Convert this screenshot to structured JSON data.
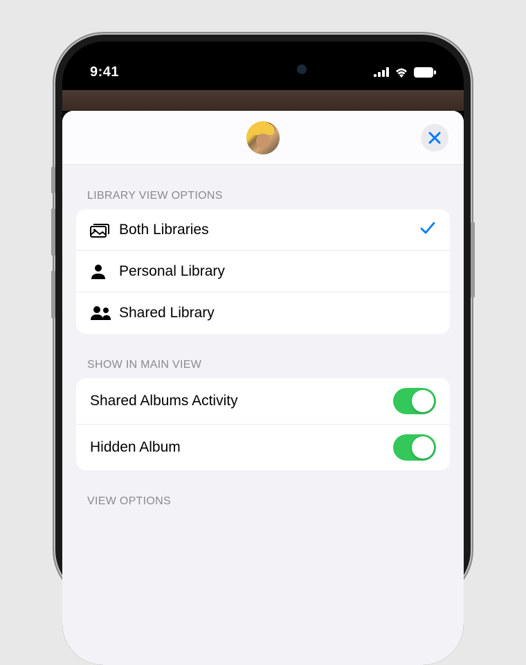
{
  "status": {
    "time": "9:41"
  },
  "sections": {
    "library": {
      "header": "LIBRARY VIEW OPTIONS",
      "items": [
        {
          "label": "Both Libraries",
          "icon": "stack-icon",
          "selected": true
        },
        {
          "label": "Personal Library",
          "icon": "person-icon",
          "selected": false
        },
        {
          "label": "Shared Library",
          "icon": "people-icon",
          "selected": false
        }
      ]
    },
    "mainview": {
      "header": "SHOW IN MAIN VIEW",
      "items": [
        {
          "label": "Shared Albums Activity",
          "enabled": true
        },
        {
          "label": "Hidden Album",
          "enabled": true
        }
      ]
    },
    "viewoptions": {
      "header": "VIEW OPTIONS"
    }
  }
}
